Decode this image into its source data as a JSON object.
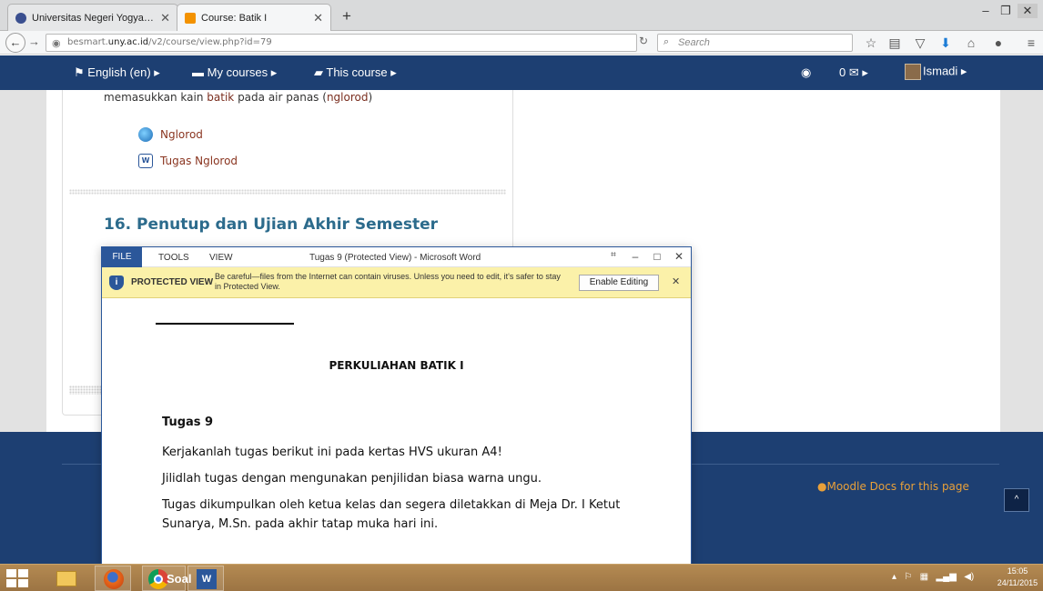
{
  "browser": {
    "tabs": [
      {
        "title": "Universitas Negeri Yogyak...",
        "favicon_color": "#3a4f8f",
        "active": false
      },
      {
        "title": "Course: Batik I",
        "favicon_color": "#f39200",
        "active": true
      }
    ],
    "new_tab_label": "+",
    "url_prefix": "besmart.",
    "url_host": "uny.ac.id",
    "url_path": "/v2/course/view.php?id=79",
    "search_placeholder": "Search",
    "toolbar_icons": [
      "star-icon",
      "reading-list-icon",
      "pocket-icon",
      "download-icon",
      "home-icon",
      "chat-icon",
      "menu-icon"
    ]
  },
  "moodle": {
    "nav": {
      "language": "English (en) ▸",
      "my_courses": "My courses ▸",
      "this_course": "This course ▸",
      "messages": "0",
      "user": "Ismadi ▸"
    },
    "summary_before": "memasukkan kain ",
    "summary_hl1": "batik",
    "summary_mid": " pada air panas (",
    "summary_hl2": "nglorod",
    "summary_after": ")",
    "resources": [
      {
        "label": "Nglorod",
        "icon": "url-icon"
      },
      {
        "label": "Tugas Nglorod",
        "icon": "word-doc-icon"
      }
    ],
    "section_heading": "16. Penutup dan Ujian Akhir Semester",
    "moodle_docs": "Moodle Docs for this page",
    "scroll_top": "^"
  },
  "word": {
    "tabs": {
      "file": "FILE",
      "tools": "TOOLS",
      "view": "VIEW"
    },
    "caption": "Tugas 9 (Protected View) - Microsoft Word",
    "protected_title": "PROTECTED VIEW",
    "protected_message": "Be careful—files from the Internet can contain viruses. Unless you need to edit, it's safer to stay in Protected View.",
    "enable_editing": "Enable Editing",
    "doc": {
      "heading": "PERKULIAHAN BATIK I",
      "task_title": "Tugas 9",
      "paragraphs": [
        "Kerjakanlah tugas berikut ini pada kertas HVS ukuran A4!",
        "Jilidlah tugas dengan mengunakan penjilidan biasa warna ungu.",
        "Tugas dikumpulkan oleh ketua kelas dan segera diletakkan di Meja Dr. I Ketut Sunarya, M.Sn. pada akhir tatap muka hari ini."
      ]
    }
  },
  "taskbar": {
    "chrome_label": "Soal",
    "time": "15:05",
    "date": "24/11/2015"
  }
}
